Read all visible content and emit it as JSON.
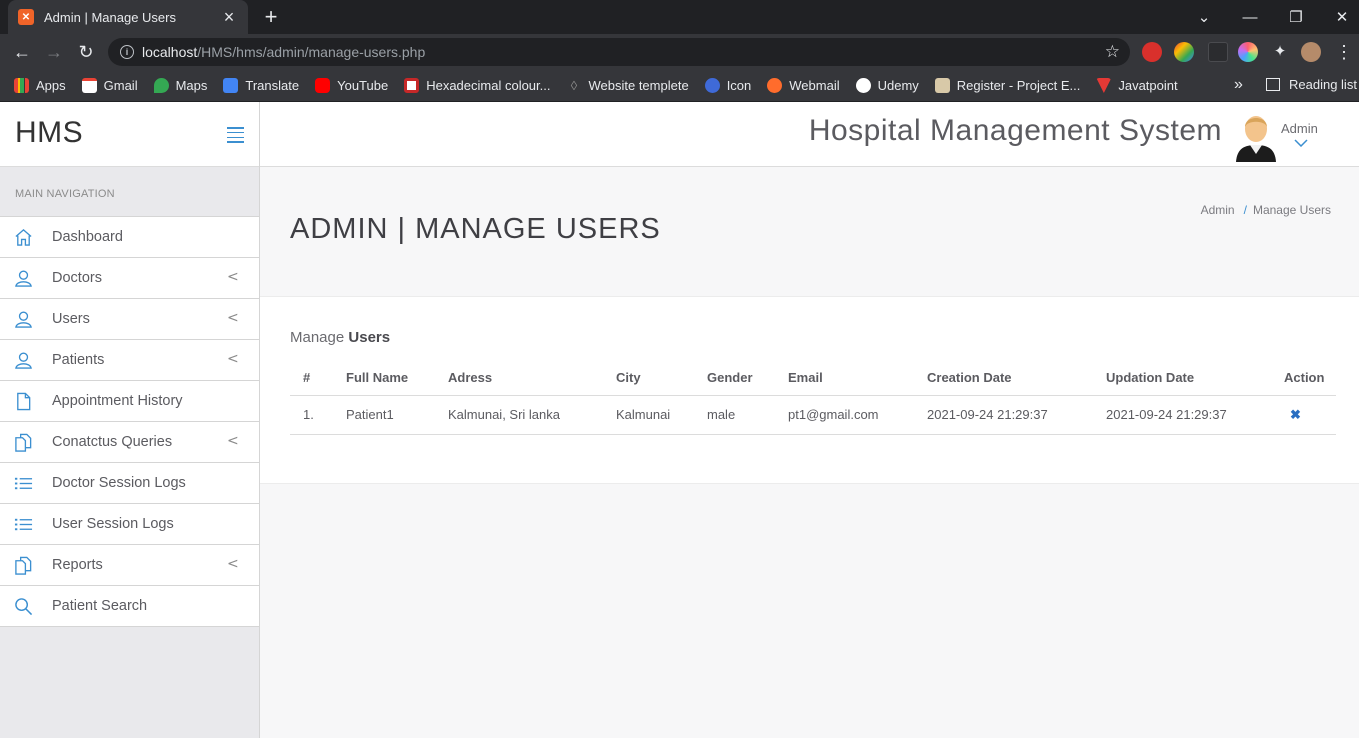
{
  "browser": {
    "tab_title": "Admin | Manage Users",
    "url_host": "localhost",
    "url_path": "/HMS/hms/admin/manage-users.php",
    "bookmarks": [
      "Apps",
      "Gmail",
      "Maps",
      "Translate",
      "YouTube",
      "Hexadecimal colour...",
      "Website templete",
      "Icon",
      "Webmail",
      "Udemy",
      "Register - Project E...",
      "Javatpoint"
    ],
    "reading_list": "Reading list",
    "more": "»"
  },
  "sidebar": {
    "brand": "HMS",
    "nav_label": "MAIN NAVIGATION",
    "items": [
      {
        "label": "Dashboard"
      },
      {
        "label": "Doctors"
      },
      {
        "label": "Users"
      },
      {
        "label": "Patients"
      },
      {
        "label": "Appointment History"
      },
      {
        "label": "Conatctus Queries"
      },
      {
        "label": "Doctor Session Logs"
      },
      {
        "label": "User Session Logs"
      },
      {
        "label": "Reports"
      },
      {
        "label": "Patient Search"
      }
    ]
  },
  "header": {
    "title": "Hospital Management System",
    "user": "Admin"
  },
  "page": {
    "title": "ADMIN | MANAGE USERS",
    "breadcrumb": [
      "Admin",
      "Manage Users"
    ],
    "panel_prefix": "Manage",
    "panel_bold": "Users"
  },
  "table": {
    "headers": [
      "#",
      "Full Name",
      "Adress",
      "City",
      "Gender",
      "Email",
      "Creation Date",
      "Updation Date",
      "Action"
    ],
    "rows": [
      [
        "1.",
        "Patient1",
        "Kalmunai, Sri lanka",
        "Kalmunai",
        "male",
        "pt1@gmail.com",
        "2021-09-24 21:29:37",
        "2021-09-24 21:29:37"
      ]
    ]
  },
  "colors": {
    "accent": "#3b8fd0",
    "delete": "#2a6fc2"
  }
}
